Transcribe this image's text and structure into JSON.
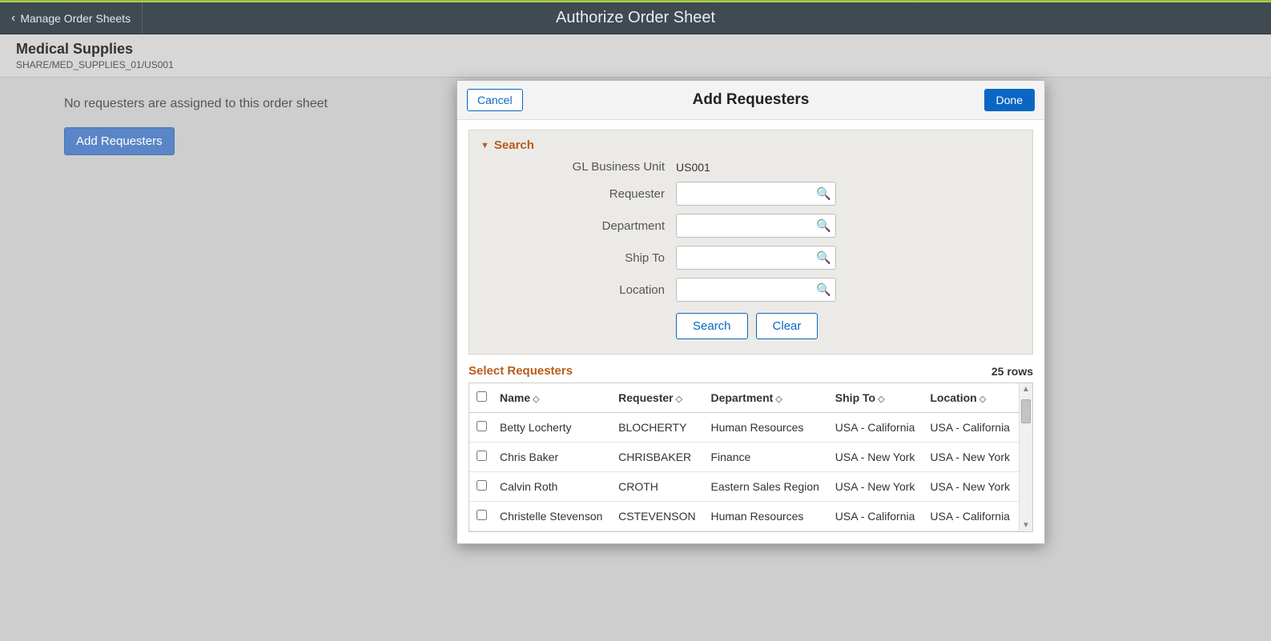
{
  "topbar": {
    "back_label": "Manage Order Sheets",
    "title": "Authorize Order Sheet"
  },
  "subheader": {
    "title": "Medical Supplies",
    "path": "SHARE/MED_SUPPLIES_01/US001"
  },
  "page": {
    "empty_msg": "No requesters are assigned to this order sheet",
    "add_btn": "Add Requesters"
  },
  "modal": {
    "cancel": "Cancel",
    "title": "Add Requesters",
    "done": "Done",
    "search": {
      "section_label": "Search",
      "gl_label": "GL Business Unit",
      "gl_value": "US001",
      "requester_label": "Requester",
      "department_label": "Department",
      "shipto_label": "Ship To",
      "location_label": "Location",
      "search_btn": "Search",
      "clear_btn": "Clear"
    },
    "results": {
      "section_label": "Select Requesters",
      "row_count": "25 rows",
      "columns": {
        "name": "Name",
        "requester": "Requester",
        "department": "Department",
        "shipto": "Ship To",
        "location": "Location"
      },
      "rows": [
        {
          "name": "Betty Locherty",
          "requester": "BLOCHERTY",
          "department": "Human Resources",
          "shipto": "USA - California",
          "location": "USA - California"
        },
        {
          "name": "Chris Baker",
          "requester": "CHRISBAKER",
          "department": "Finance",
          "shipto": "USA - New York",
          "location": "USA - New York"
        },
        {
          "name": "Calvin Roth",
          "requester": "CROTH",
          "department": "Eastern Sales Region",
          "shipto": "USA - New York",
          "location": "USA - New York"
        },
        {
          "name": "Christelle Stevenson",
          "requester": "CSTEVENSON",
          "department": "Human Resources",
          "shipto": "USA - California",
          "location": "USA - California"
        }
      ]
    }
  }
}
